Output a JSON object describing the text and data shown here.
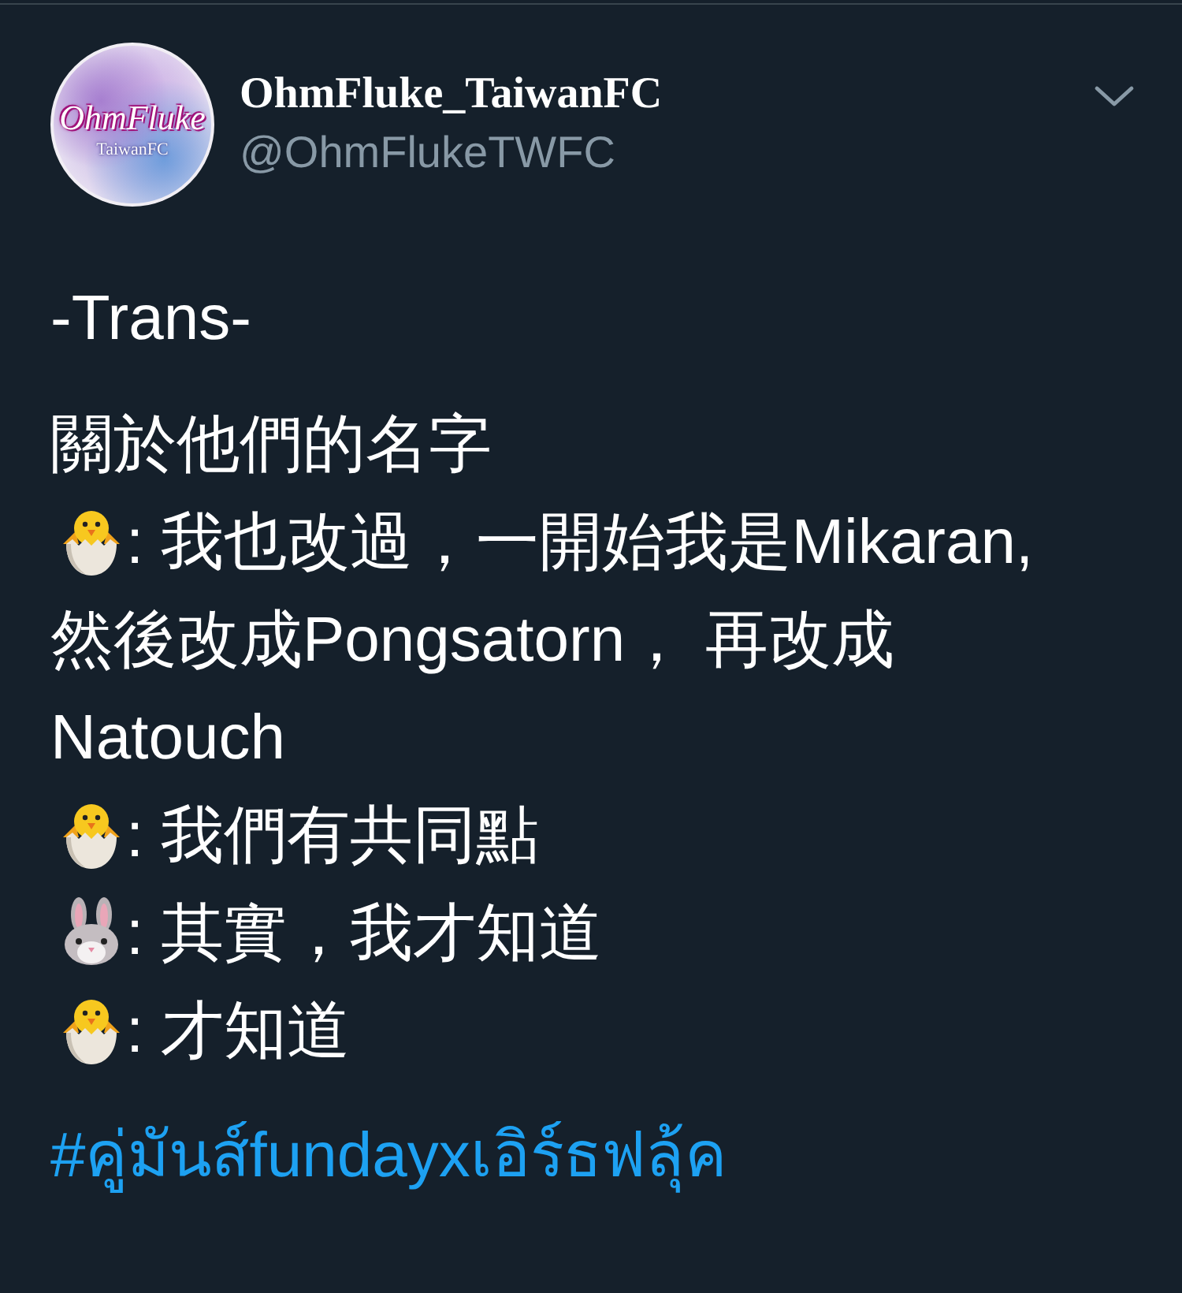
{
  "tweet": {
    "avatar": {
      "title": "OhmFluke",
      "subtitle": "TaiwanFC"
    },
    "author": {
      "name": "OhmFluke_TaiwanFC",
      "handle": "@OhmFlukeTWFC"
    },
    "title": "-Trans-",
    "lines": [
      {
        "kind": "plain",
        "rows": [
          "關於他們的名字"
        ]
      },
      {
        "kind": "chick",
        "rows": [
          ": 我也改過，一開始我是Mikaran,",
          "然後改成Pongsatorn， 再改成",
          "Natouch"
        ]
      },
      {
        "kind": "chick",
        "rows": [
          ": 我們有共同點"
        ]
      },
      {
        "kind": "rabbit",
        "rows": [
          ": 其實，我才知道"
        ]
      },
      {
        "kind": "chick",
        "rows": [
          ": 才知道"
        ]
      }
    ],
    "hashtag": "#คู่มันส์fundayxเอิร์ธฟลุ้ค"
  }
}
